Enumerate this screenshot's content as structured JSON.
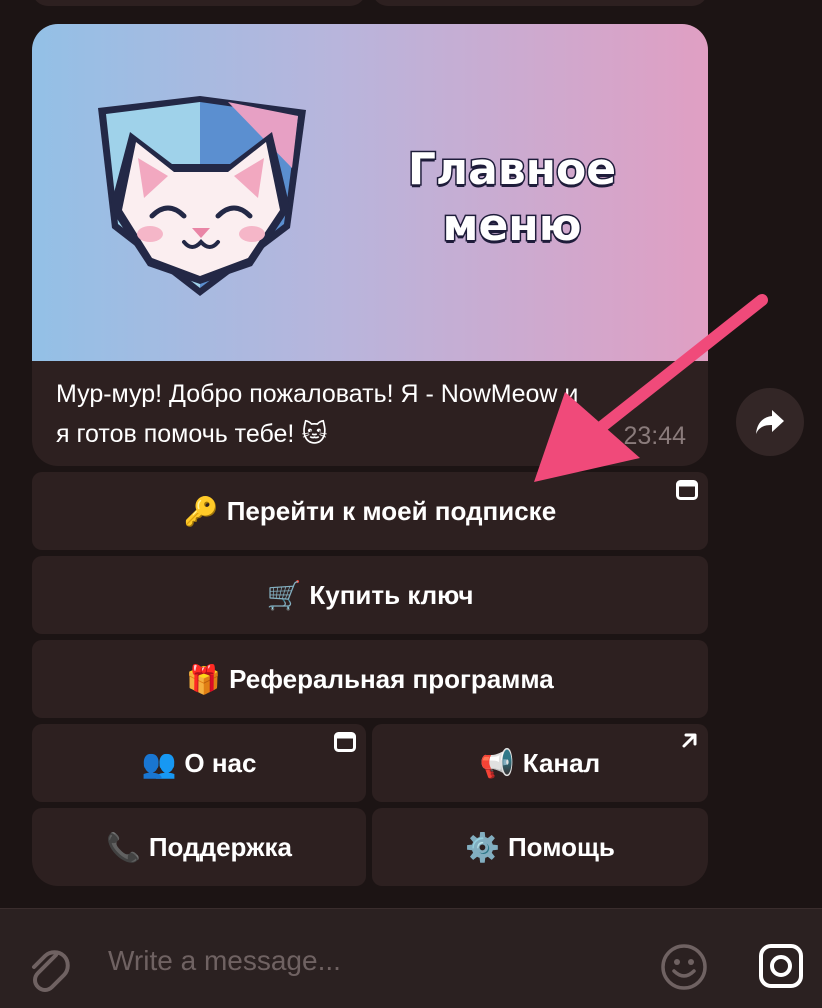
{
  "banner": {
    "title_line1": "Главное",
    "title_line2": "меню"
  },
  "message": {
    "line1": "Мур-мур! Добро пожаловать! Я - NowMeow и",
    "line2": "я готов помочь тебе! 🐱",
    "time": "23:44"
  },
  "keyboard": {
    "subscription": {
      "emoji": "🔑",
      "label": "Перейти к моей подписке"
    },
    "buy_key": {
      "emoji": "🛒",
      "label": "Купить ключ"
    },
    "referral": {
      "emoji": "🎁",
      "label": "Реферальная программа"
    },
    "about": {
      "emoji": "👥",
      "label": "О нас"
    },
    "channel": {
      "emoji": "📢",
      "label": "Канал"
    },
    "support": {
      "emoji": "📞",
      "label": "Поддержка"
    },
    "help": {
      "emoji": "⚙️",
      "label": "Помощь"
    }
  },
  "composer": {
    "placeholder": "Write a message..."
  },
  "colors": {
    "background": "#1c1414",
    "bubble": "#2d2020",
    "annotation_arrow": "#f04a7a"
  },
  "icons": [
    "share-icon",
    "webapp-icon",
    "external-link-icon",
    "paperclip-icon",
    "emoji-icon",
    "instagram-icon",
    "cat-logo-icon"
  ]
}
